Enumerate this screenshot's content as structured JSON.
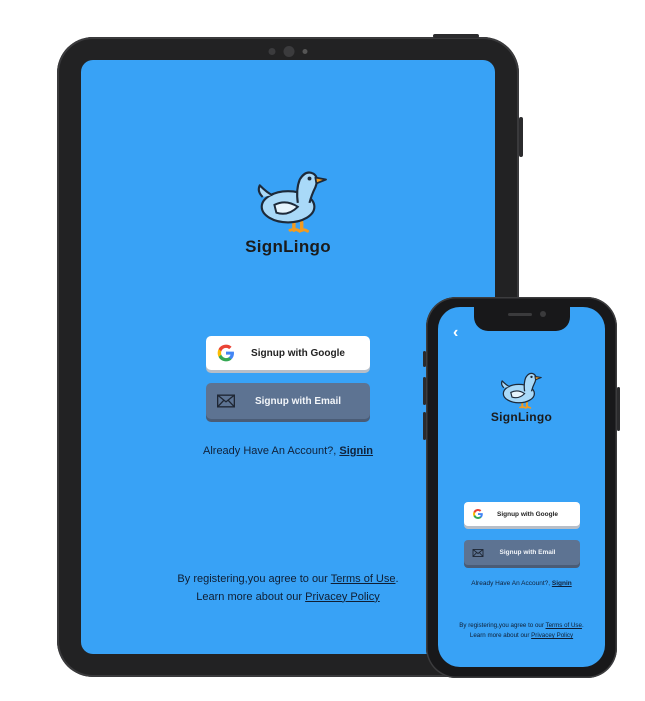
{
  "app": {
    "name": "SignLingo"
  },
  "auth": {
    "google_button": "Signup with Google",
    "email_button": "Signup with Email",
    "already_prefix": "Already Have An Account?, ",
    "signin_link": "Signin",
    "terms_prefix": "By registering,you agree to our ",
    "terms_link": "Terms of Use",
    "terms_suffix": ".",
    "privacy_prefix": "Learn more about our ",
    "privacy_link": "Privacey Policy"
  },
  "nav": {
    "back_icon": "chevron-left-icon"
  },
  "colors": {
    "screen_background": "#38a2f6",
    "email_button": "#5d7392",
    "google_button": "#ffffff",
    "device_frame": "#222223"
  }
}
